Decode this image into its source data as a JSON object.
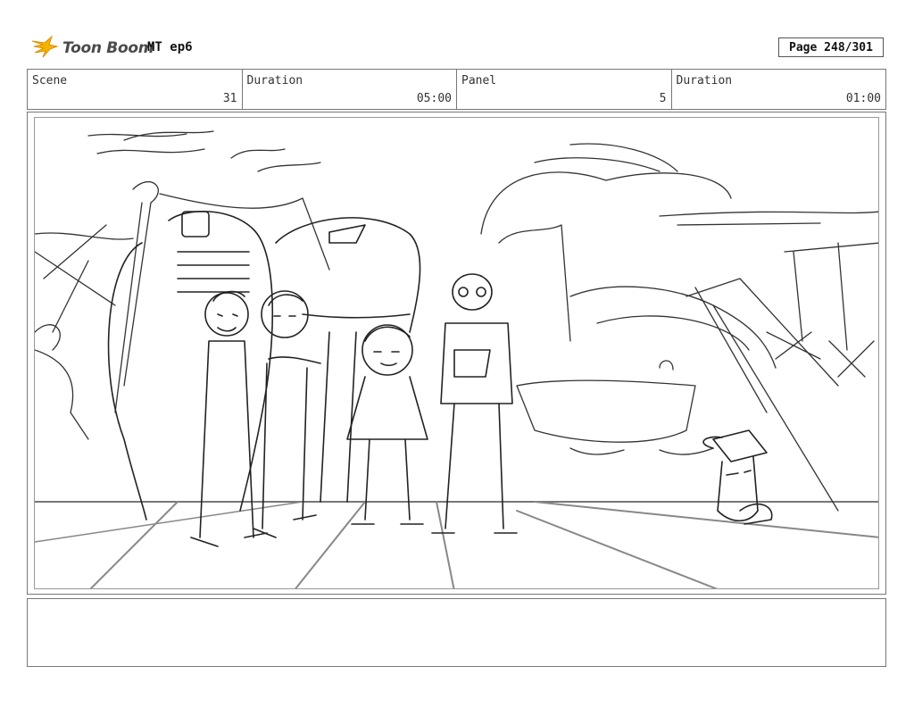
{
  "header": {
    "logo_text": "Toon Boom",
    "title": "MT ep6",
    "page_label": "Page 248/301"
  },
  "info": {
    "scene": {
      "label": "Scene",
      "value": "31"
    },
    "scene_duration": {
      "label": "Duration",
      "value": "05:00"
    },
    "panel": {
      "label": "Panel",
      "value": "5"
    },
    "panel_duration": {
      "label": "Duration",
      "value": "01:00"
    }
  },
  "colors": {
    "logo_star": "#f4b400",
    "sketch_line": "#333333",
    "border": "#777777"
  },
  "icons": {
    "logo": "toon-boom-star-icon"
  },
  "notes": {
    "text": ""
  }
}
